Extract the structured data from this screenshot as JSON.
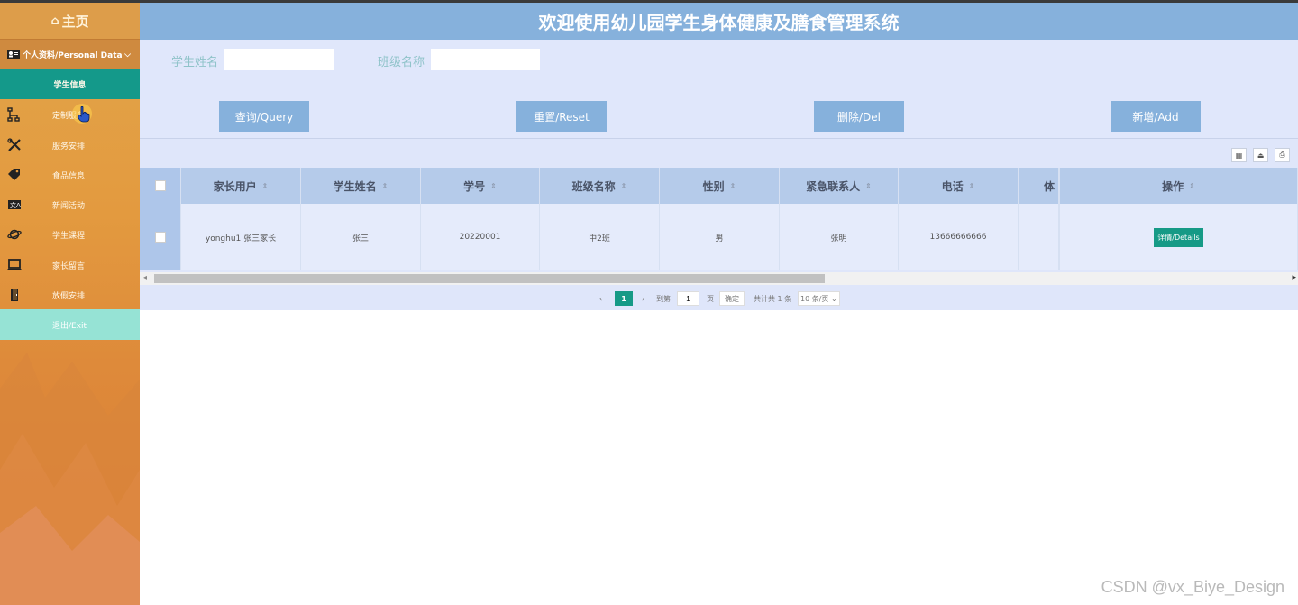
{
  "header": {
    "title": "欢迎使用幼儿园学生身体健康及膳食管理系统"
  },
  "sidebar": {
    "home_label": "主页",
    "section_label": "个人资料/Personal Data",
    "items": [
      {
        "label": "学生信息",
        "icon": "none",
        "active": true
      },
      {
        "label": "定制服务",
        "icon": "org-chart-icon"
      },
      {
        "label": "服务安排",
        "icon": "tools-icon"
      },
      {
        "label": "食品信息",
        "icon": "tag-icon"
      },
      {
        "label": "新闻活动",
        "icon": "translate-icon"
      },
      {
        "label": "学生课程",
        "icon": "planet-icon"
      },
      {
        "label": "家长留言",
        "icon": "laptop-icon"
      },
      {
        "label": "放假安排",
        "icon": "door-icon"
      }
    ],
    "exit_label": "退出/Exit"
  },
  "search": {
    "student_name_label": "学生姓名",
    "student_name_value": "",
    "class_name_label": "班级名称",
    "class_name_value": ""
  },
  "buttons": {
    "query": "查询/Query",
    "reset": "重置/Reset",
    "delete": "删除/Del",
    "add": "新增/Add"
  },
  "table": {
    "columns": [
      "家长用户",
      "学生姓名",
      "学号",
      "班级名称",
      "性别",
      "紧急联系人",
      "电话",
      "体",
      "操作"
    ],
    "rows": [
      {
        "parent_user": "yonghu1 张三家长",
        "student_name": "张三",
        "student_no": "20220001",
        "class_name": "中2班",
        "gender": "男",
        "emergency_contact": "张明",
        "phone": "13666666666",
        "partial": "",
        "action": "详情/Details"
      }
    ]
  },
  "pagination": {
    "current_page": "1",
    "goto_label": "到第",
    "goto_value": "1",
    "page_unit": "页",
    "confirm_label": "确定",
    "total_label": "共计共 1 条",
    "page_size_label": "10 条/页"
  },
  "watermark": "CSDN @vx_Biye_Design",
  "colors": {
    "sidebar_active": "#14998a",
    "header": "#86b1dc",
    "panel": "#e0e7fb",
    "exit": "#96e3d5"
  }
}
